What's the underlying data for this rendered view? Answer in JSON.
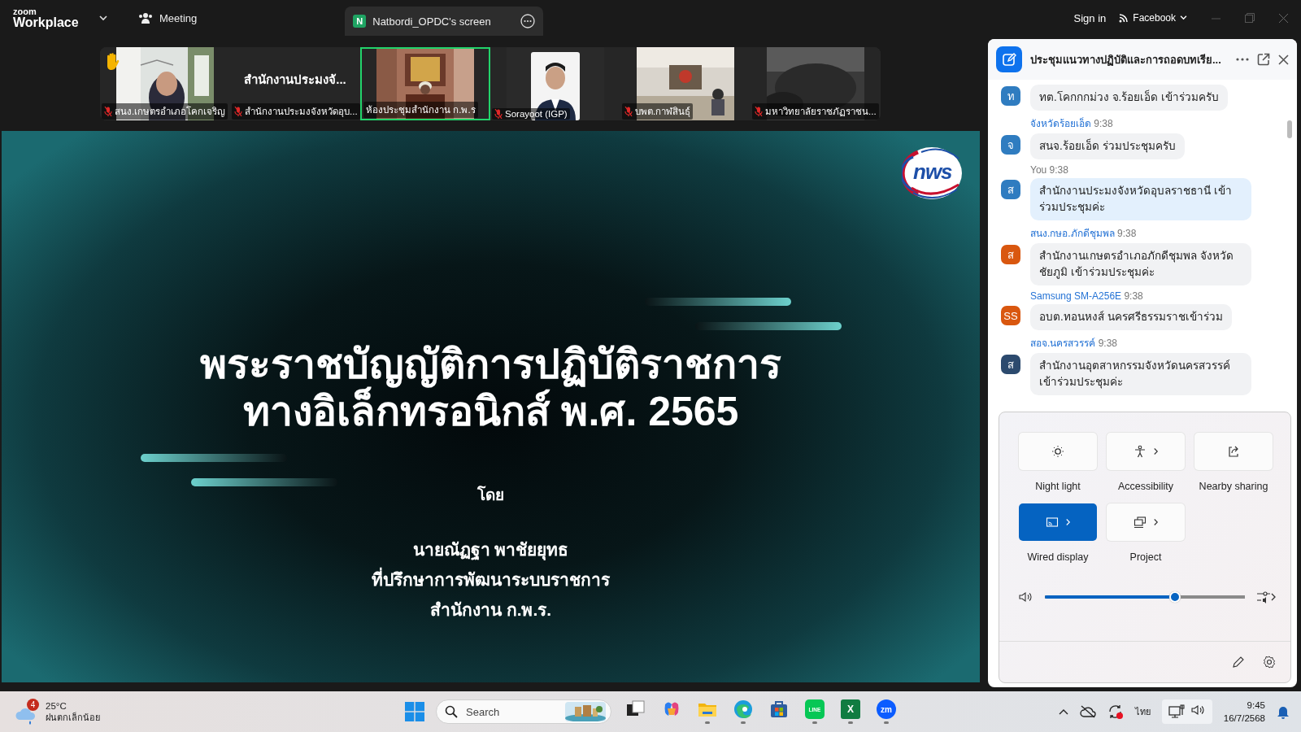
{
  "app_bar": {
    "logo_top": "zoom",
    "logo_bottom": "Workplace",
    "meeting_tab": "Meeting",
    "share_tab": {
      "badge": "N",
      "label": "Natbordi_OPDC's screen"
    },
    "sign_in": "Sign in",
    "account": "Facebook"
  },
  "gallery": [
    {
      "kind": "video",
      "label": "สนง.เกษตรอำเภอโคกเจริญ",
      "muted": true,
      "selected": false,
      "hand": true
    },
    {
      "kind": "name",
      "name": "สำนักงานประมงจั...",
      "label": "สำนักงานประมงจังหวัดอุบ...",
      "muted": true,
      "selected": false,
      "hand": false
    },
    {
      "kind": "video",
      "label": "ห้องประชุมสำนักงาน ก.พ.ร",
      "muted": false,
      "selected": true,
      "hand": false
    },
    {
      "kind": "video",
      "label": "Sorayoot (IGP)",
      "muted": true,
      "selected": false,
      "hand": false
    },
    {
      "kind": "video",
      "label": "บพต.กาฬสินธุ์",
      "muted": true,
      "selected": false,
      "hand": false
    },
    {
      "kind": "video",
      "label": "มหาวิทยาลัยราชภัฏราชน...",
      "muted": true,
      "selected": false,
      "hand": false
    }
  ],
  "slide": {
    "logo_text": "nws",
    "title_lines": [
      "พระราชบัญญัติการปฏิบัติราชการ",
      "ทางอิเล็กทรอนิกส์ พ.ศ. 2565"
    ],
    "by": "โดย",
    "presenter_lines": [
      "นายณัฏฐา พาชัยยุทธ",
      "ที่ปรึกษาการพัฒนาระบบราชการ",
      "สำนักงาน ก.พ.ร."
    ]
  },
  "chat": {
    "title": "ประชุมแนวทางปฏิบัติและการถอดบทเรีย...",
    "messages": [
      {
        "initial": "ท",
        "color": "#2f7cc0",
        "mine": false,
        "text": "ทต.โคกกกม่วง จ.ร้อยเอ็ด เข้าร่วมครับ"
      },
      {
        "sender": "จังหวัดร้อยเอ็ด",
        "time": "9:38",
        "initial": "จ",
        "color": "#2f7cc0",
        "mine": false,
        "text": "สนจ.ร้อยเอ็ด ร่วมประชุมครับ"
      },
      {
        "sender": "You",
        "time": "9:38",
        "initial": "ส",
        "color": "#2f7cc0",
        "mine": true,
        "text": "สำนักงานประมงจังหวัดอุบลราชธานี เข้าร่วมประชุมค่ะ"
      },
      {
        "sender": "สนง.กษอ.ภักดีชุมพล",
        "time": "9:38",
        "initial": "ส",
        "color": "#d9570f",
        "mine": false,
        "text": "สำนักงานเกษตรอำเภอภักดีชุมพล จังหวัดชัยภูมิ เข้าร่วมประชุมค่ะ"
      },
      {
        "sender": "Samsung SM-A256E",
        "time": "9:38",
        "initial": "SS",
        "color": "#d9570f",
        "mine": false,
        "text": "อบต.ทอนหงส์ นครศรีธรรมราชเข้าร่วม"
      },
      {
        "sender": "สอจ.นครสวรรค์",
        "time": "9:38",
        "initial": "ส",
        "color": "#2c4a6e",
        "mine": false,
        "text": "สำนักงานอุตสาหกรรมจังหวัดนครสวรรค์ เข้าร่วมประชุมค่ะ"
      }
    ]
  },
  "quick_settings": {
    "tiles": [
      {
        "kind": "night-light",
        "label": "Night light",
        "on": false,
        "has_menu": false
      },
      {
        "kind": "accessibility",
        "label": "Accessibility",
        "on": false,
        "has_menu": true
      },
      {
        "kind": "nearby-sharing",
        "label": "Nearby sharing",
        "on": false,
        "has_menu": false
      },
      {
        "kind": "wired-display",
        "label": "Wired display",
        "on": true,
        "has_menu": true
      },
      {
        "kind": "project",
        "label": "Project",
        "on": false,
        "has_menu": true
      }
    ],
    "volume": {
      "level": 0.65
    }
  },
  "taskbar": {
    "weather": {
      "badge": "4",
      "temperature": "25°C",
      "condition": "ฝนตกเล็กน้อย"
    },
    "search": {
      "placeholder": "Search"
    },
    "apps": [
      {
        "kind": "task-view",
        "running": false
      },
      {
        "kind": "copilot",
        "running": false
      },
      {
        "kind": "files",
        "running": true
      },
      {
        "kind": "edge",
        "running": true
      },
      {
        "kind": "store",
        "running": false
      },
      {
        "kind": "line",
        "running": true,
        "glyph": "LINE"
      },
      {
        "kind": "excel",
        "running": true,
        "glyph": "X"
      },
      {
        "kind": "zoom",
        "running": true,
        "glyph": "zm"
      }
    ],
    "language": "ไทย",
    "time": "9:45",
    "date": "16/7/2568"
  }
}
